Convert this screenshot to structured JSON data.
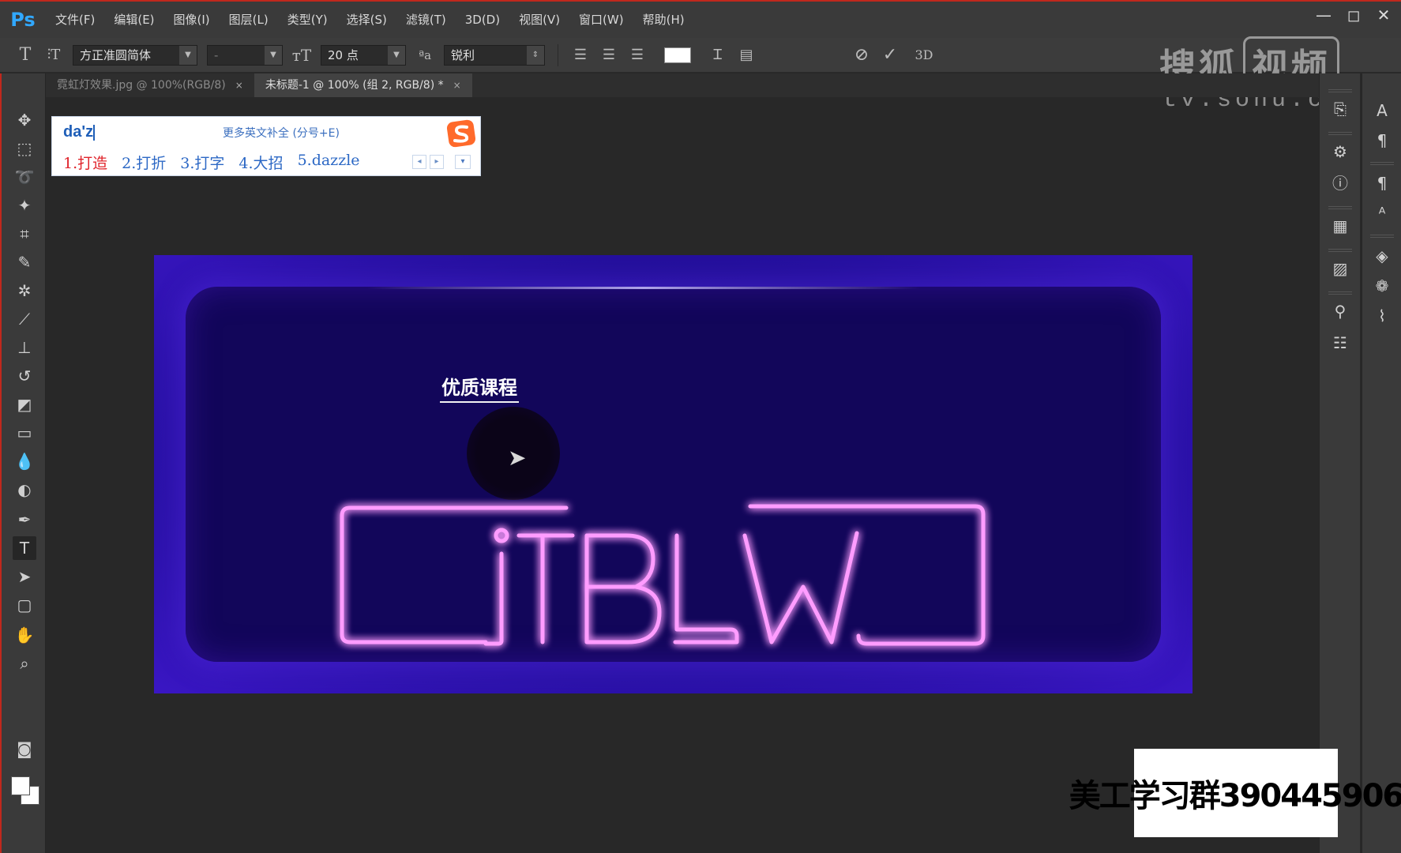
{
  "app": {
    "logo": "Ps"
  },
  "menubar": {
    "items": [
      "文件(F)",
      "编辑(E)",
      "图像(I)",
      "图层(L)",
      "类型(Y)",
      "选择(S)",
      "滤镜(T)",
      "3D(D)",
      "视图(V)",
      "窗口(W)",
      "帮助(H)"
    ]
  },
  "window_controls": {
    "minimize": "—",
    "maximize": "◻",
    "close": "✕"
  },
  "options_bar": {
    "tool_icon": "T",
    "font_family": "方正准圆简体",
    "font_style": "-",
    "font_size": "20 点",
    "aa_label": "ªa",
    "antialias": "锐利",
    "commit_label": "3D"
  },
  "tabs": [
    {
      "label": "霓虹灯效果.jpg @ 100%(RGB/8)",
      "close": "×",
      "active": false
    },
    {
      "label": "未标题-1 @ 100% (组 2, RGB/8) *",
      "close": "×",
      "active": true
    }
  ],
  "ime": {
    "input": "da'z",
    "hint": "更多英文补全 (分号+E)",
    "candidates": [
      "1.打造",
      "2.打折",
      "3.打字",
      "4.大招",
      "5.dazzle"
    ],
    "prev": "◂",
    "next": "▸",
    "more": "▾"
  },
  "canvas": {
    "title_text": "优质课程",
    "neon_text": "iTBLW",
    "colors": {
      "bg_outer": "#3a16c4",
      "bg_inner": "#12065a",
      "neon": "#ff8cff",
      "neon_glow": "#c020e0"
    }
  },
  "watermark": {
    "brand": "搜狐",
    "badge": "视频",
    "url": "tv.sohu.com"
  },
  "group_label": "美工学习群390445906",
  "icons": {
    "tools": [
      "move-icon",
      "marquee-icon",
      "lasso-icon",
      "magic-wand-icon",
      "crop-icon",
      "eyedropper-icon",
      "healing-icon",
      "brush-icon",
      "stamp-icon",
      "history-brush-icon",
      "eraser-icon",
      "gradient-icon",
      "blur-icon",
      "dodge-icon",
      "pen-icon",
      "type-icon",
      "path-select-icon",
      "shape-icon",
      "hand-icon",
      "zoom-icon"
    ]
  }
}
